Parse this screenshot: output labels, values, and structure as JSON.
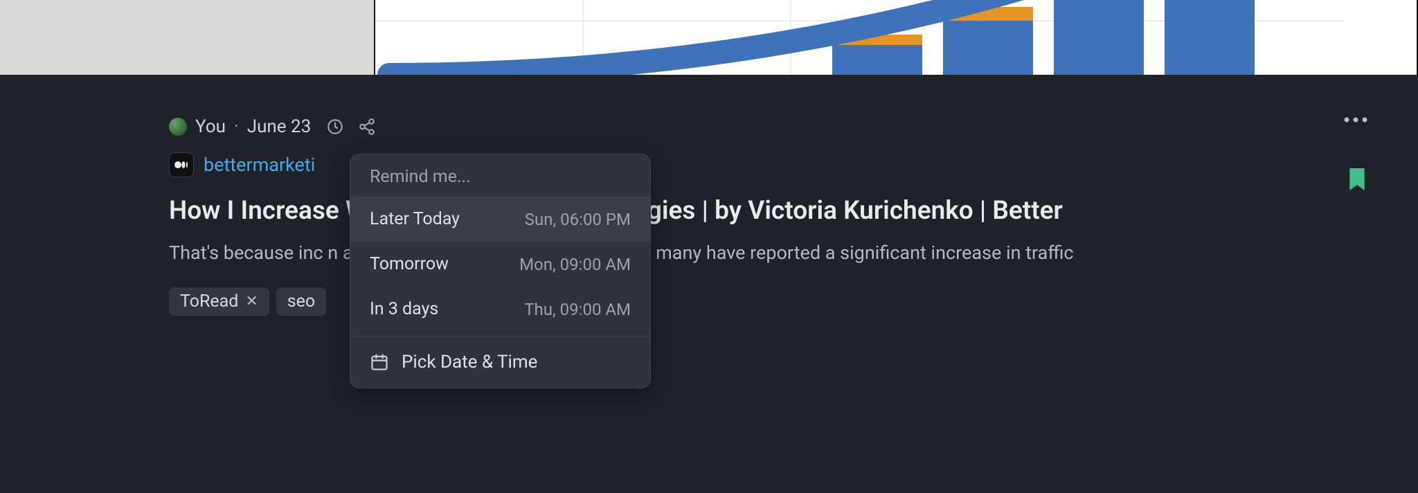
{
  "hero": {
    "alt": "bar chart with rising blue bars and upward curve"
  },
  "post": {
    "author": "You",
    "date": "June 23",
    "source_domain": "bettermarketi",
    "source_badge": "•••",
    "title": "How I Increase                               Website — 3 Proven Strategies | by Victoria Kurichenko | Better",
    "excerpt": "That's because inc                                           n a challenge for site owners. However, many have reported a significant increase in traffic",
    "tags": [
      {
        "label": "ToRead",
        "removable": true
      },
      {
        "label": "seo",
        "removable": false
      }
    ]
  },
  "menu": {
    "header": "Remind me...",
    "options": [
      {
        "label": "Later Today",
        "when": "Sun, 06:00 PM",
        "selected": true
      },
      {
        "label": "Tomorrow",
        "when": "Mon, 09:00 AM",
        "selected": false
      },
      {
        "label": "In 3 days",
        "when": "Thu, 09:00 AM",
        "selected": false
      }
    ],
    "pick_label": "Pick Date & Time"
  },
  "icons": {
    "clock": "clock-icon",
    "share": "share-icon",
    "more": "more-icon",
    "bookmark": "bookmark-icon",
    "calendar": "calendar-icon"
  },
  "colors": {
    "accent_link": "#4aa8e8",
    "bookmark": "#3fbf8f",
    "bg_card": "#1f2329",
    "bg_dropdown": "#2f333a"
  }
}
